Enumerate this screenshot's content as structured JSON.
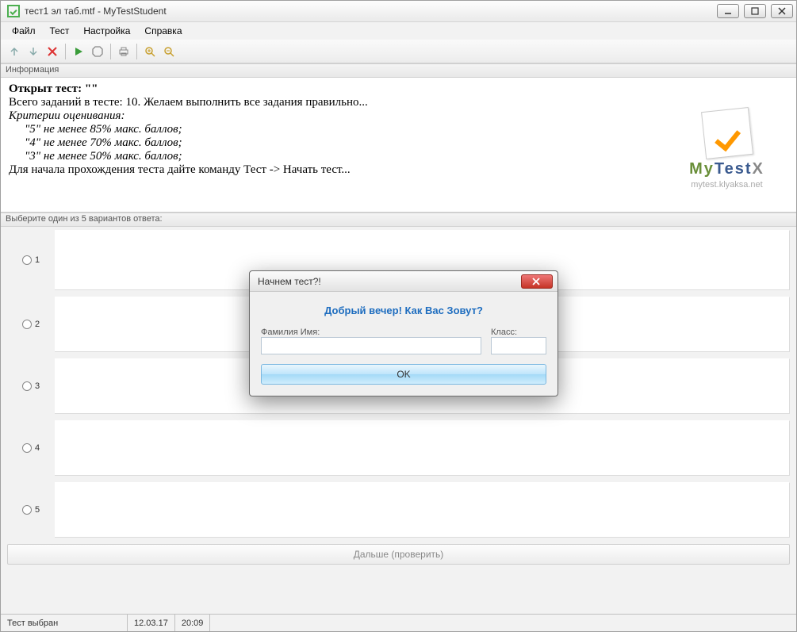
{
  "title": "тест1 эл таб.mtf - MyTestStudent",
  "menu": {
    "file": "Файл",
    "test": "Тест",
    "settings": "Настройка",
    "help": "Справка"
  },
  "sections": {
    "info": "Информация",
    "choose": "Выберите один из 5 вариантов ответа:"
  },
  "info": {
    "opened": "Открыт тест: \"\"",
    "total": "Всего заданий в тесте: 10. Желаем выполнить все задания правильно...",
    "criteria_head": "Критерии оценивания:",
    "c5": "\"5\" не менее 85% макс. баллов;",
    "c4": "\"4\" не менее 70% макс. баллов;",
    "c3": "\"3\" не менее 50% макс. баллов;",
    "start": "Для начала прохождения теста дайте команду Тест -> Начать тест..."
  },
  "brand": {
    "my": "My",
    "test": "Test",
    "x": "X",
    "url": "mytest.klyaksa.net"
  },
  "answers": {
    "n1": "1",
    "n2": "2",
    "n3": "3",
    "n4": "4",
    "n5": "5"
  },
  "next_label": "Дальше (проверить)",
  "status": {
    "state": "Тест выбран",
    "date": "12.03.17",
    "time": "20:09"
  },
  "dialog": {
    "title": "Начнем тест?!",
    "greeting": "Добрый вечер! Как Вас Зовут?",
    "name_label": "Фамилия Имя:",
    "class_label": "Класс:",
    "name_value": "",
    "class_value": "",
    "ok": "OK"
  }
}
